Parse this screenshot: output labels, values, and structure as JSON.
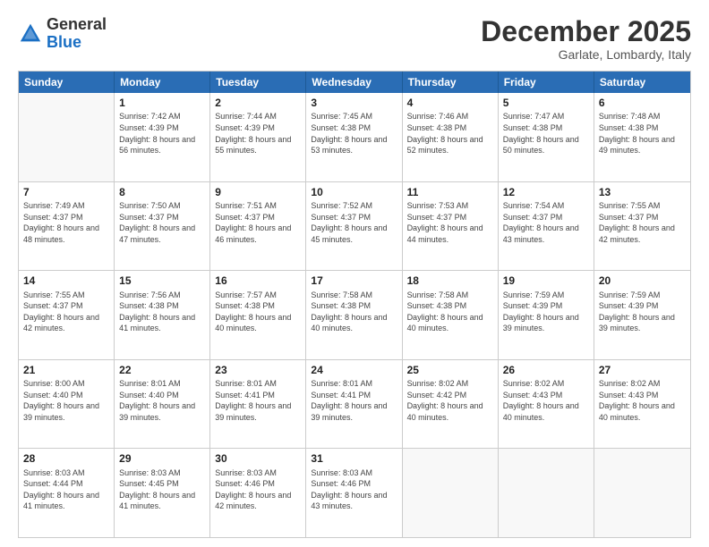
{
  "header": {
    "logo_general": "General",
    "logo_blue": "Blue",
    "month_title": "December 2025",
    "subtitle": "Garlate, Lombardy, Italy"
  },
  "weekdays": [
    "Sunday",
    "Monday",
    "Tuesday",
    "Wednesday",
    "Thursday",
    "Friday",
    "Saturday"
  ],
  "weeks": [
    [
      {
        "day": "",
        "empty": true,
        "sunrise": "",
        "sunset": "",
        "daylight": ""
      },
      {
        "day": "1",
        "sunrise": "Sunrise: 7:42 AM",
        "sunset": "Sunset: 4:39 PM",
        "daylight": "Daylight: 8 hours and 56 minutes."
      },
      {
        "day": "2",
        "sunrise": "Sunrise: 7:44 AM",
        "sunset": "Sunset: 4:39 PM",
        "daylight": "Daylight: 8 hours and 55 minutes."
      },
      {
        "day": "3",
        "sunrise": "Sunrise: 7:45 AM",
        "sunset": "Sunset: 4:38 PM",
        "daylight": "Daylight: 8 hours and 53 minutes."
      },
      {
        "day": "4",
        "sunrise": "Sunrise: 7:46 AM",
        "sunset": "Sunset: 4:38 PM",
        "daylight": "Daylight: 8 hours and 52 minutes."
      },
      {
        "day": "5",
        "sunrise": "Sunrise: 7:47 AM",
        "sunset": "Sunset: 4:38 PM",
        "daylight": "Daylight: 8 hours and 50 minutes."
      },
      {
        "day": "6",
        "sunrise": "Sunrise: 7:48 AM",
        "sunset": "Sunset: 4:38 PM",
        "daylight": "Daylight: 8 hours and 49 minutes."
      }
    ],
    [
      {
        "day": "7",
        "sunrise": "Sunrise: 7:49 AM",
        "sunset": "Sunset: 4:37 PM",
        "daylight": "Daylight: 8 hours and 48 minutes."
      },
      {
        "day": "8",
        "sunrise": "Sunrise: 7:50 AM",
        "sunset": "Sunset: 4:37 PM",
        "daylight": "Daylight: 8 hours and 47 minutes."
      },
      {
        "day": "9",
        "sunrise": "Sunrise: 7:51 AM",
        "sunset": "Sunset: 4:37 PM",
        "daylight": "Daylight: 8 hours and 46 minutes."
      },
      {
        "day": "10",
        "sunrise": "Sunrise: 7:52 AM",
        "sunset": "Sunset: 4:37 PM",
        "daylight": "Daylight: 8 hours and 45 minutes."
      },
      {
        "day": "11",
        "sunrise": "Sunrise: 7:53 AM",
        "sunset": "Sunset: 4:37 PM",
        "daylight": "Daylight: 8 hours and 44 minutes."
      },
      {
        "day": "12",
        "sunrise": "Sunrise: 7:54 AM",
        "sunset": "Sunset: 4:37 PM",
        "daylight": "Daylight: 8 hours and 43 minutes."
      },
      {
        "day": "13",
        "sunrise": "Sunrise: 7:55 AM",
        "sunset": "Sunset: 4:37 PM",
        "daylight": "Daylight: 8 hours and 42 minutes."
      }
    ],
    [
      {
        "day": "14",
        "sunrise": "Sunrise: 7:55 AM",
        "sunset": "Sunset: 4:37 PM",
        "daylight": "Daylight: 8 hours and 42 minutes."
      },
      {
        "day": "15",
        "sunrise": "Sunrise: 7:56 AM",
        "sunset": "Sunset: 4:38 PM",
        "daylight": "Daylight: 8 hours and 41 minutes."
      },
      {
        "day": "16",
        "sunrise": "Sunrise: 7:57 AM",
        "sunset": "Sunset: 4:38 PM",
        "daylight": "Daylight: 8 hours and 40 minutes."
      },
      {
        "day": "17",
        "sunrise": "Sunrise: 7:58 AM",
        "sunset": "Sunset: 4:38 PM",
        "daylight": "Daylight: 8 hours and 40 minutes."
      },
      {
        "day": "18",
        "sunrise": "Sunrise: 7:58 AM",
        "sunset": "Sunset: 4:38 PM",
        "daylight": "Daylight: 8 hours and 40 minutes."
      },
      {
        "day": "19",
        "sunrise": "Sunrise: 7:59 AM",
        "sunset": "Sunset: 4:39 PM",
        "daylight": "Daylight: 8 hours and 39 minutes."
      },
      {
        "day": "20",
        "sunrise": "Sunrise: 7:59 AM",
        "sunset": "Sunset: 4:39 PM",
        "daylight": "Daylight: 8 hours and 39 minutes."
      }
    ],
    [
      {
        "day": "21",
        "sunrise": "Sunrise: 8:00 AM",
        "sunset": "Sunset: 4:40 PM",
        "daylight": "Daylight: 8 hours and 39 minutes."
      },
      {
        "day": "22",
        "sunrise": "Sunrise: 8:01 AM",
        "sunset": "Sunset: 4:40 PM",
        "daylight": "Daylight: 8 hours and 39 minutes."
      },
      {
        "day": "23",
        "sunrise": "Sunrise: 8:01 AM",
        "sunset": "Sunset: 4:41 PM",
        "daylight": "Daylight: 8 hours and 39 minutes."
      },
      {
        "day": "24",
        "sunrise": "Sunrise: 8:01 AM",
        "sunset": "Sunset: 4:41 PM",
        "daylight": "Daylight: 8 hours and 39 minutes."
      },
      {
        "day": "25",
        "sunrise": "Sunrise: 8:02 AM",
        "sunset": "Sunset: 4:42 PM",
        "daylight": "Daylight: 8 hours and 40 minutes."
      },
      {
        "day": "26",
        "sunrise": "Sunrise: 8:02 AM",
        "sunset": "Sunset: 4:43 PM",
        "daylight": "Daylight: 8 hours and 40 minutes."
      },
      {
        "day": "27",
        "sunrise": "Sunrise: 8:02 AM",
        "sunset": "Sunset: 4:43 PM",
        "daylight": "Daylight: 8 hours and 40 minutes."
      }
    ],
    [
      {
        "day": "28",
        "sunrise": "Sunrise: 8:03 AM",
        "sunset": "Sunset: 4:44 PM",
        "daylight": "Daylight: 8 hours and 41 minutes."
      },
      {
        "day": "29",
        "sunrise": "Sunrise: 8:03 AM",
        "sunset": "Sunset: 4:45 PM",
        "daylight": "Daylight: 8 hours and 41 minutes."
      },
      {
        "day": "30",
        "sunrise": "Sunrise: 8:03 AM",
        "sunset": "Sunset: 4:46 PM",
        "daylight": "Daylight: 8 hours and 42 minutes."
      },
      {
        "day": "31",
        "sunrise": "Sunrise: 8:03 AM",
        "sunset": "Sunset: 4:46 PM",
        "daylight": "Daylight: 8 hours and 43 minutes."
      },
      {
        "day": "",
        "empty": true
      },
      {
        "day": "",
        "empty": true
      },
      {
        "day": "",
        "empty": true
      }
    ]
  ]
}
